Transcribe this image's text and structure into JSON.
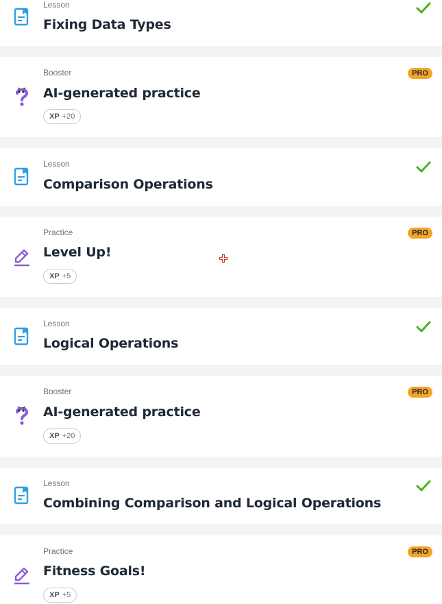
{
  "items": [
    {
      "type": "Lesson",
      "title": "Fixing Data Types",
      "icon": "lesson-icon",
      "completed": true
    },
    {
      "type": "Booster",
      "title": "AI-generated practice",
      "icon": "question-mark-icon",
      "pro": "PRO",
      "xp_label": "XP",
      "xp_value": "+20"
    },
    {
      "type": "Lesson",
      "title": "Comparison Operations",
      "icon": "lesson-icon",
      "completed": true
    },
    {
      "type": "Practice",
      "title": "Level Up!",
      "icon": "pencil-icon",
      "pro": "PRO",
      "xp_label": "XP",
      "xp_value": "+5"
    },
    {
      "type": "Lesson",
      "title": "Logical Operations",
      "icon": "lesson-icon",
      "completed": true
    },
    {
      "type": "Booster",
      "title": "AI-generated practice",
      "icon": "question-mark-icon",
      "pro": "PRO",
      "xp_label": "XP",
      "xp_value": "+20"
    },
    {
      "type": "Lesson",
      "title": "Combining Comparison and Logical Operations",
      "icon": "lesson-icon",
      "completed": true
    },
    {
      "type": "Practice",
      "title": "Fitness Goals!",
      "icon": "pencil-icon",
      "pro": "PRO",
      "xp_label": "XP",
      "xp_value": "+5"
    }
  ],
  "colors": {
    "lesson_icon": "#2e9fe6",
    "practice_icon": "#8b5cd6",
    "check": "#46b21a",
    "pro": "#f5a524"
  }
}
